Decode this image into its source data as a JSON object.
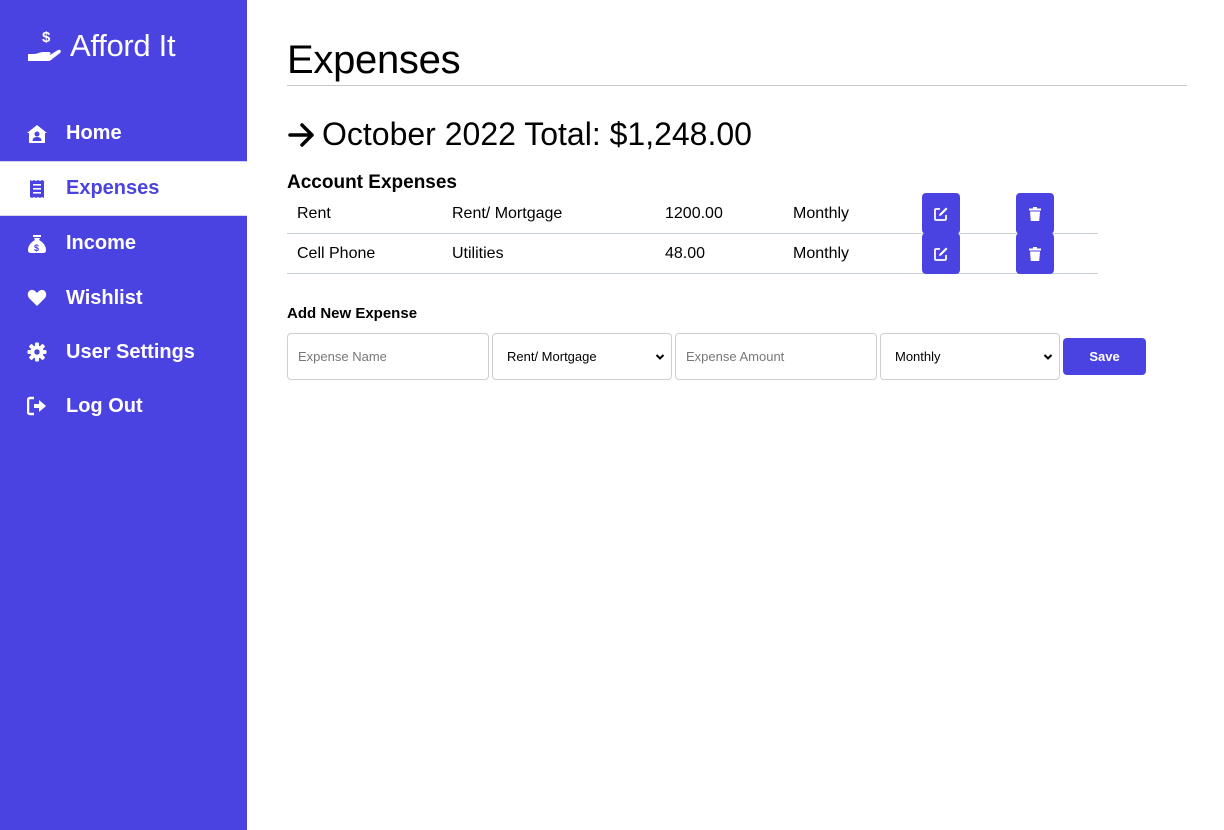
{
  "app": {
    "title": "Afford It",
    "brand_color": "#4a43e2"
  },
  "sidebar": {
    "items": [
      {
        "label": "Home",
        "icon": "house-user-icon",
        "active": false
      },
      {
        "label": "Expenses",
        "icon": "receipt-icon",
        "active": true
      },
      {
        "label": "Income",
        "icon": "money-bag-icon",
        "active": false
      },
      {
        "label": "Wishlist",
        "icon": "heart-icon",
        "active": false
      },
      {
        "label": "User Settings",
        "icon": "gear-icon",
        "active": false
      },
      {
        "label": "Log Out",
        "icon": "sign-out-icon",
        "active": false
      }
    ]
  },
  "main": {
    "page_title": "Expenses",
    "total_label": "October 2022 Total: $1,248.00",
    "section_title": "Account Expenses",
    "expenses": [
      {
        "name": "Rent",
        "category": "Rent/ Mortgage",
        "amount": "1200.00",
        "frequency": "Monthly"
      },
      {
        "name": "Cell Phone",
        "category": "Utilities",
        "amount": "48.00",
        "frequency": "Monthly"
      }
    ],
    "add_form": {
      "title": "Add New Expense",
      "name_placeholder": "Expense Name",
      "name_value": "",
      "category_selected": "Rent/ Mortgage",
      "amount_placeholder": "Expense Amount",
      "amount_value": "",
      "frequency_selected": "Monthly",
      "save_label": "Save"
    }
  }
}
